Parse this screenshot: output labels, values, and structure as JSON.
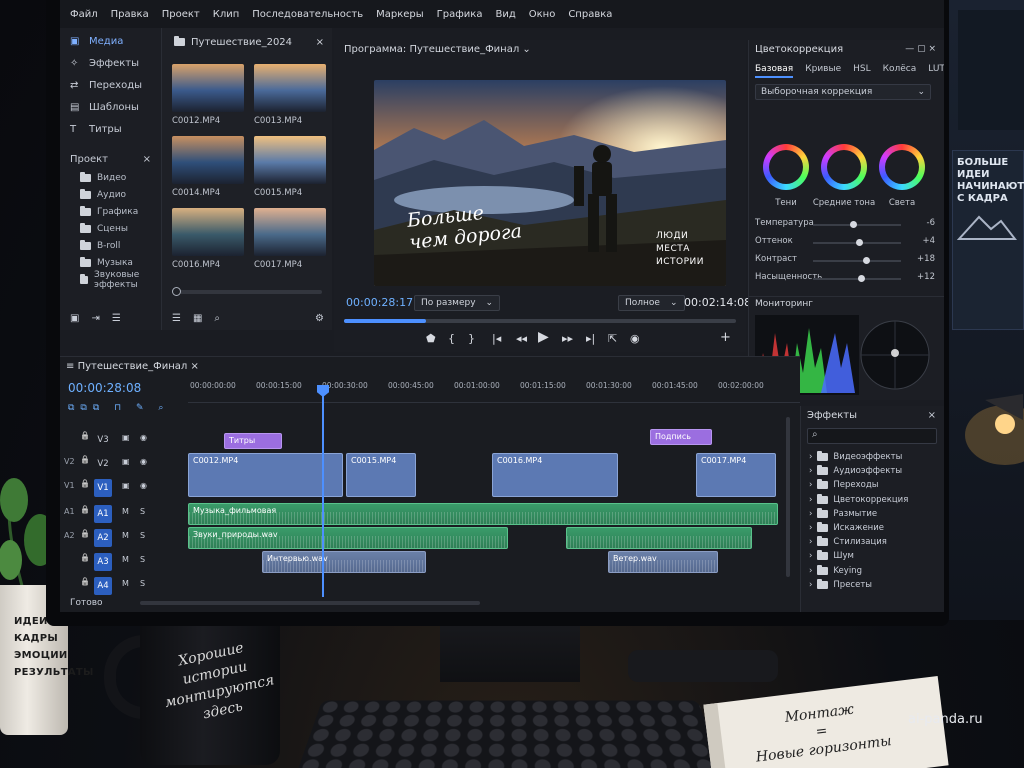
{
  "menu": [
    "Файл",
    "Правка",
    "Проект",
    "Клип",
    "Последовательность",
    "Маркеры",
    "Графика",
    "Вид",
    "Окно",
    "Справка"
  ],
  "nav": [
    {
      "label": "Медиа",
      "icon": "media-folder-icon",
      "active": true
    },
    {
      "label": "Эффекты",
      "icon": "effects-icon",
      "active": false
    },
    {
      "label": "Переходы",
      "icon": "transitions-icon",
      "active": false
    },
    {
      "label": "Шаблоны",
      "icon": "templates-icon",
      "active": false
    },
    {
      "label": "Титры",
      "icon": "text-icon",
      "active": false
    }
  ],
  "project": {
    "title": "Проект",
    "folders": [
      "Видео",
      "Аудио",
      "Графика",
      "Сцены",
      "B-roll",
      "Музыка",
      "Звуковые эффекты"
    ]
  },
  "bin": {
    "title": "Путешествие_2024",
    "clips": [
      "C0012.MP4",
      "C0013.MP4",
      "C0014.MP4",
      "C0015.MP4",
      "C0016.MP4",
      "C0017.MP4"
    ]
  },
  "program": {
    "title": "Программа: Путешествие_Финал",
    "overlay_title": "Больше\nчем дорога",
    "overlay_words": "ЛЮДИ\nМЕСТА\nИСТОРИИ",
    "timecode": "00:00:28:17",
    "fit": "По размеру",
    "quality": "Полное",
    "duration": "00:02:14:08",
    "progress": 0.21
  },
  "color": {
    "title": "Цветокоррекция",
    "tabs": [
      "Базовая",
      "Кривые",
      "HSL",
      "Колёса",
      "LUT"
    ],
    "select": "Выборочная коррекция",
    "wheels": [
      "Тени",
      "Средние тона",
      "Света"
    ],
    "sliders": [
      {
        "label": "Температура",
        "value": "-6",
        "pos": 0.45
      },
      {
        "label": "Оттенок",
        "value": "+4",
        "pos": 0.52
      },
      {
        "label": "Контраст",
        "value": "+18",
        "pos": 0.6
      },
      {
        "label": "Насыщенность",
        "value": "+12",
        "pos": 0.55
      }
    ]
  },
  "monitoring": {
    "title": "Мониторинг"
  },
  "timeline": {
    "tab": "Путешествие_Финал",
    "timecode": "00:00:28:08",
    "ruler": [
      "00:00:00:00",
      "00:00:15:00",
      "00:00:30:00",
      "00:00:45:00",
      "00:01:00:00",
      "00:01:15:00",
      "00:01:30:00",
      "00:01:45:00",
      "00:02:00:00"
    ],
    "tracks": [
      "V3",
      "V2",
      "V1",
      "A1",
      "A2",
      "A3",
      "A4"
    ],
    "src": [
      "V2",
      "V1",
      "A1",
      "A2"
    ],
    "title_clip": "Титры",
    "title_clip2": "Подпись",
    "clips_v1": [
      "C0012.MP4",
      "C0015.MP4",
      "C0016.MP4",
      "C0017.MP4"
    ],
    "audio": [
      "Музыка_фильмовая",
      "Звуки_природы.wav",
      "Интервью.wav",
      "Ветер.wav"
    ],
    "status": "Готово"
  },
  "effects": {
    "title": "Эффекты",
    "items": [
      "Видеоэффекты",
      "Аудиоэффекты",
      "Переходы",
      "Цветокоррекция",
      "Размытие",
      "Искажение",
      "Стилизация",
      "Шум",
      "Keying",
      "Пресеты"
    ]
  },
  "desk": {
    "cup_lines": [
      "ИДЕИ",
      "КАДРЫ",
      "ЭМОЦИИ",
      "РЕЗУЛЬТАТЫ"
    ],
    "mug_text": "Хорошие\nистории\nмонтируются\nздесь",
    "note_text": "Монтаж\n=\nНовые горизонты",
    "poster_text": "БОЛЬШЕ\nИДЕИ\nНАЧИНАЮТСЯ\nС КАДРА",
    "watermark": "ai-panda.ru"
  }
}
